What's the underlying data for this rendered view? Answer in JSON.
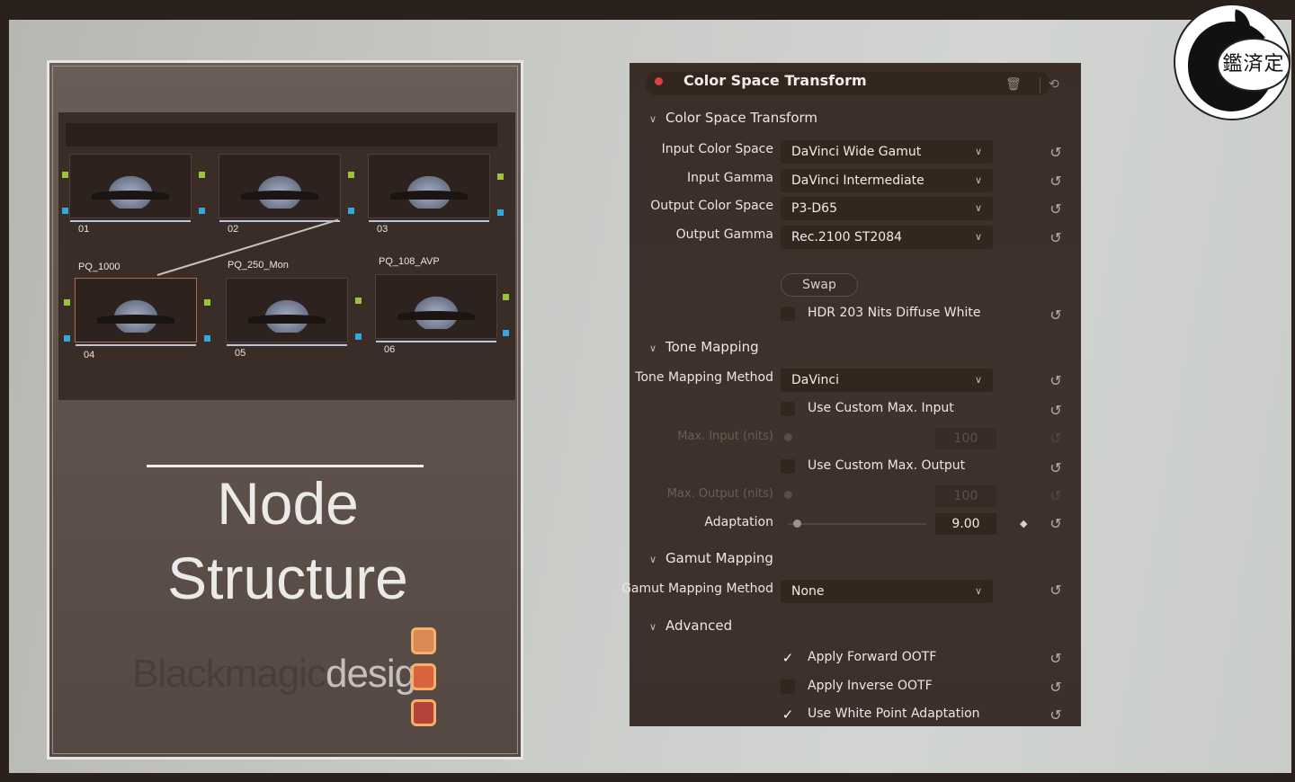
{
  "slide": {
    "nodes": [
      {
        "id": "01",
        "name": ""
      },
      {
        "id": "02",
        "name": ""
      },
      {
        "id": "03",
        "name": ""
      },
      {
        "id": "04",
        "name": "PQ_1000"
      },
      {
        "id": "05",
        "name": "PQ_250_Mon"
      },
      {
        "id": "06",
        "name": "PQ_108_AVP"
      }
    ],
    "title_line1": "Node",
    "title_line2": "Structure",
    "brand_part1": "Blackmagic",
    "brand_part2": "design",
    "brand_colors": [
      "#d98952",
      "#d8643f",
      "#b6433a"
    ]
  },
  "panel": {
    "title": "Color Space Transform",
    "header_icons": [
      "trash-icon",
      "reset-all-icon"
    ],
    "sections": {
      "cst": "Color Space Transform",
      "tone": "Tone Mapping",
      "gamut": "Gamut Mapping",
      "advanced": "Advanced"
    },
    "input_color_space": {
      "label": "Input Color Space",
      "value": "DaVinci Wide Gamut"
    },
    "input_gamma": {
      "label": "Input Gamma",
      "value": "DaVinci Intermediate"
    },
    "output_color_space": {
      "label": "Output Color Space",
      "value": "P3-D65"
    },
    "output_gamma": {
      "label": "Output Gamma",
      "value": "Rec.2100 ST2084"
    },
    "swap_label": "Swap",
    "hdr_diffuse": {
      "label": "HDR 203 Nits Diffuse White",
      "checked": false
    },
    "tone_mapping_method": {
      "label": "Tone Mapping Method",
      "value": "DaVinci"
    },
    "custom_max_input": {
      "label": "Use Custom Max. Input",
      "checked": false
    },
    "max_input": {
      "label": "Max. Input (nits)",
      "value": "100"
    },
    "custom_max_output": {
      "label": "Use Custom Max. Output",
      "checked": false
    },
    "max_output": {
      "label": "Max. Output (nits)",
      "value": "100"
    },
    "adaptation": {
      "label": "Adaptation",
      "value": "9.00"
    },
    "gamut_mapping_method": {
      "label": "Gamut Mapping Method",
      "value": "None"
    },
    "apply_forward_ootf": {
      "label": "Apply Forward OOTF",
      "checked": true
    },
    "apply_inverse_ootf": {
      "label": "Apply Inverse OOTF",
      "checked": false
    },
    "white_point_adaptation": {
      "label": "Use White Point Adaptation",
      "checked": true
    },
    "accent_red": "#e0413b"
  },
  "watermark": {
    "seal_text": "鑑済定"
  }
}
